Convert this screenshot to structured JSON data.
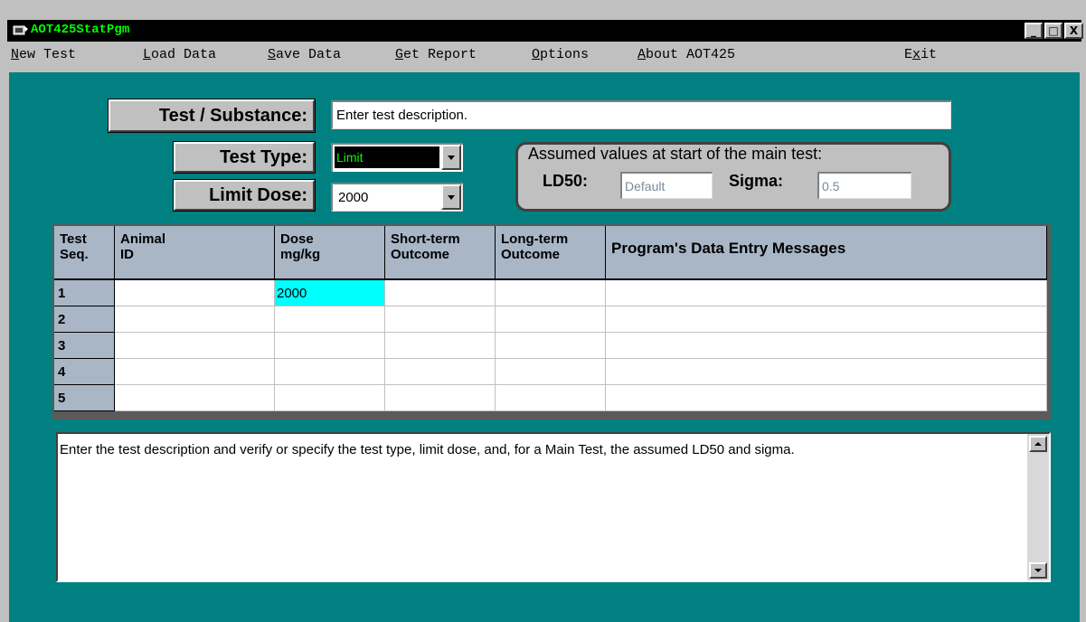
{
  "window": {
    "title": "AOT425StatPgm",
    "buttons": {
      "minimize": "_",
      "maximize": "□",
      "close": "X"
    }
  },
  "menu": {
    "items": [
      {
        "accel": "N",
        "rest": "ew Test"
      },
      {
        "accel": "L",
        "rest": "oad Data"
      },
      {
        "accel": "S",
        "rest": "ave Data"
      },
      {
        "accel": "G",
        "rest": "et Report"
      },
      {
        "accel": "O",
        "rest": "ptions"
      },
      {
        "accel": "A",
        "rest": "bout AOT425"
      },
      {
        "pre": "E",
        "accel": "x",
        "rest": "it"
      }
    ]
  },
  "form": {
    "substance_label": "Test / Substance:",
    "substance_value": "Enter test description.",
    "test_type_label": "Test Type:",
    "test_type_value": "Limit",
    "limit_dose_label": "Limit Dose:",
    "limit_dose_value": "2000"
  },
  "assumed": {
    "title": "Assumed values at start of the main test:",
    "ld50_label": "LD50:",
    "ld50_value": "Default",
    "sigma_label": "Sigma:",
    "sigma_value": "0.5"
  },
  "grid": {
    "columns": [
      {
        "line1": "Test",
        "line2": "Seq."
      },
      {
        "line1": "Animal",
        "line2": "ID"
      },
      {
        "line1": "Dose",
        "line2": "mg/kg"
      },
      {
        "line1": "Short-term",
        "line2": "Outcome"
      },
      {
        "line1": "Long-term",
        "line2": "Outcome"
      },
      {
        "line1": "Program's Data Entry Messages",
        "line2": ""
      }
    ],
    "rows": [
      {
        "seq": "1",
        "animal_id": "",
        "dose": "2000",
        "short_term": "",
        "long_term": "",
        "message": ""
      },
      {
        "seq": "2",
        "animal_id": "",
        "dose": "",
        "short_term": "",
        "long_term": "",
        "message": ""
      },
      {
        "seq": "3",
        "animal_id": "",
        "dose": "",
        "short_term": "",
        "long_term": "",
        "message": ""
      },
      {
        "seq": "4",
        "animal_id": "",
        "dose": "",
        "short_term": "",
        "long_term": "",
        "message": ""
      },
      {
        "seq": "5",
        "animal_id": "",
        "dose": "",
        "short_term": "",
        "long_term": "",
        "message": ""
      }
    ]
  },
  "message_box": {
    "text": "Enter the test description and verify or specify the test type, limit dose, and, for a Main Test, the assumed LD50 and sigma."
  },
  "colors": {
    "title_text": "#00ff00",
    "client_background": "#008080",
    "selected_cell": "#00ffff",
    "grid_header": "#a9b6c6"
  }
}
